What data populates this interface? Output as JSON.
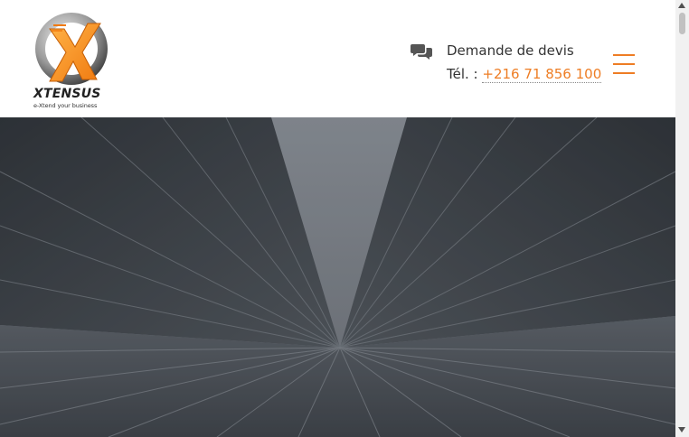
{
  "brand": {
    "name": "XTENSUS",
    "tagline": "e-Xtend your business"
  },
  "header": {
    "quote_label": "Demande de devis",
    "phone_prefix": "Tél. :",
    "phone_number": "+216 71 856 100",
    "quote_icon": "chat-bubbles-icon",
    "menu_icon": "hamburger-menu-icon"
  },
  "colors": {
    "accent": "#ee7d24",
    "text": "#333333",
    "hero": "#5a5f66"
  }
}
